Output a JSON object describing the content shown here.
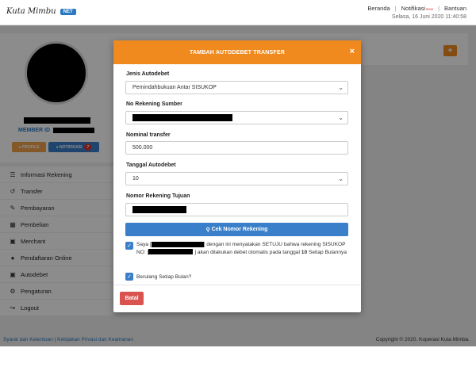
{
  "header": {
    "logo_text": "Kuta Mimbu",
    "logo_badge": "NET",
    "nav": [
      {
        "label": "Beranda"
      },
      {
        "label": "Notifikasi",
        "badge": "New"
      },
      {
        "label": "Bantuan"
      }
    ],
    "datetime": "Selasa, 16 Juni 2020 11:40:58"
  },
  "profile": {
    "member_label": "MEMBER ID",
    "profile_button": "PROFILE",
    "notif_button": "NOTIFIKASI",
    "notif_count": "7"
  },
  "sidebar": {
    "items": [
      {
        "label": "Informasi Rekening",
        "icon": "list-icon"
      },
      {
        "label": "Transfer",
        "icon": "transfer-icon"
      },
      {
        "label": "Pembayaran",
        "icon": "edit-icon"
      },
      {
        "label": "Pembelian",
        "icon": "grid-icon"
      },
      {
        "label": "Merchant",
        "icon": "cart-icon"
      },
      {
        "label": "Pendaftaran Online",
        "icon": "user-icon"
      },
      {
        "label": "Autodebet",
        "icon": "calendar-icon"
      },
      {
        "label": "Pengaturan",
        "icon": "gear-icon"
      },
      {
        "label": "Logout",
        "icon": "logout-icon"
      }
    ]
  },
  "footer": {
    "left": "Syarat dan Ketentuan | Kebijakan Privasi dan Keamanan",
    "right": "Copyright © 2020. Koperasi Kuta Mimba."
  },
  "modal": {
    "title": "TAMBAH AUTODEBET TRANSFER",
    "close": "×",
    "jenis_label": "Jenis Autodebet",
    "jenis_value": "Pemindahbukuan Antar SISUKOP",
    "rekening_sumber_label": "No Rekening Sumber",
    "nominal_label": "Nominal transfer",
    "nominal_value": "500.000",
    "tanggal_label": "Tanggal Autodebet",
    "tanggal_value": "10",
    "tujuan_label": "Nomor Rekening Tujuan",
    "cek_button": "Cek Nomor Rekening",
    "agree_prefix": "Saya [",
    "agree_mid1": "] dengan ini menyatakan SETUJU bahwa rekening SISUKOP NO: [",
    "agree_mid2": "] akan dilakukan debet otomatis pada tanggal",
    "agree_day": "10",
    "agree_suffix": "Setiap Bulannya",
    "repeat_label": "Berulang Setiap Bulan?",
    "cancel_button": "Batal"
  },
  "colors": {
    "accent_orange": "#f08a1e",
    "primary_blue": "#3a7fc9",
    "danger_red": "#d9534f"
  }
}
